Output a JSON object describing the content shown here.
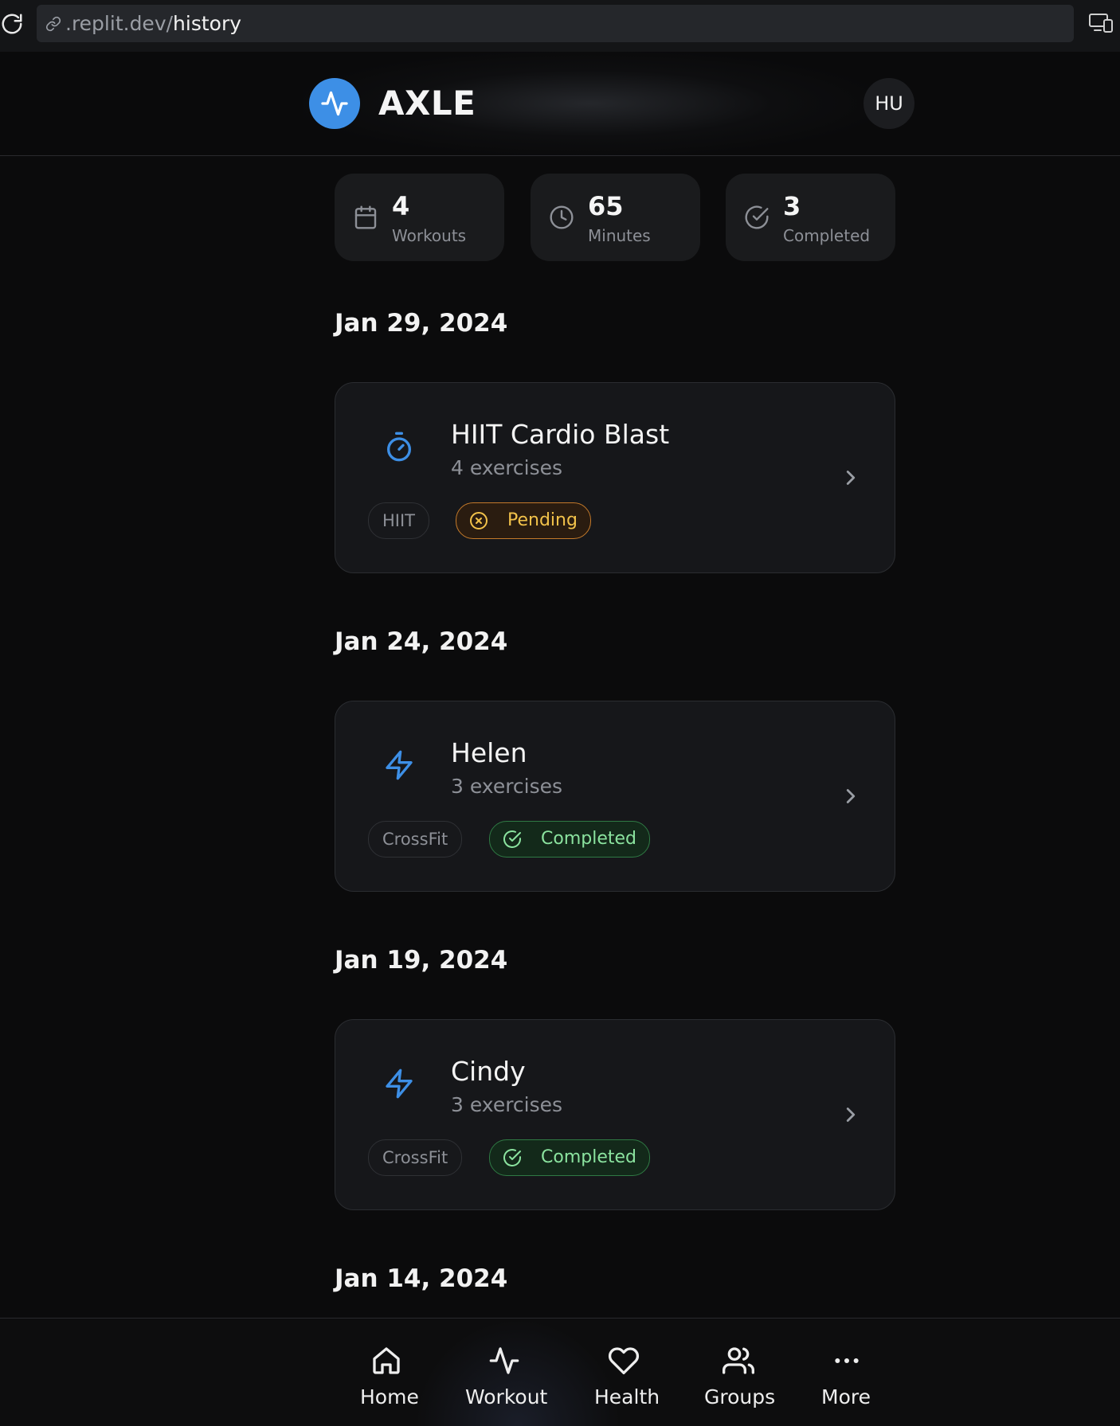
{
  "browser": {
    "url_host": ".replit.dev/",
    "url_path": "history",
    "icons": [
      "reload-icon",
      "link-icon",
      "devices-icon"
    ]
  },
  "header": {
    "brand": "AXLE",
    "avatar_initials": "HU",
    "logo_icon": "activity-icon",
    "accent_color": "#3d8fe6"
  },
  "stats": [
    {
      "value": "4",
      "label": "Workouts",
      "icon": "calendar-icon"
    },
    {
      "value": "65",
      "label": "Minutes",
      "icon": "clock-icon"
    },
    {
      "value": "3",
      "label": "Completed",
      "icon": "check-circle-icon"
    }
  ],
  "groups": [
    {
      "date": "Jan 29, 2024",
      "workout": {
        "title": "HIIT Cardio Blast",
        "subtitle": "4 exercises",
        "tag": "HIIT",
        "status": "Pending",
        "icon": "timer-icon"
      }
    },
    {
      "date": "Jan 24, 2024",
      "workout": {
        "title": "Helen",
        "subtitle": "3 exercises",
        "tag": "CrossFit",
        "status": "Completed",
        "icon": "bolt-icon"
      }
    },
    {
      "date": "Jan 19, 2024",
      "workout": {
        "title": "Cindy",
        "subtitle": "3 exercises",
        "tag": "CrossFit",
        "status": "Completed",
        "icon": "bolt-icon"
      }
    },
    {
      "date": "Jan 14, 2024"
    }
  ],
  "status_colors": {
    "pending": "#f2c24a",
    "completed": "#8be39f"
  },
  "nav": [
    {
      "label": "Home",
      "icon": "home-icon"
    },
    {
      "label": "Workout",
      "icon": "activity-icon"
    },
    {
      "label": "Health",
      "icon": "heart-icon"
    },
    {
      "label": "Groups",
      "icon": "users-icon"
    },
    {
      "label": "More",
      "icon": "more-icon"
    }
  ]
}
